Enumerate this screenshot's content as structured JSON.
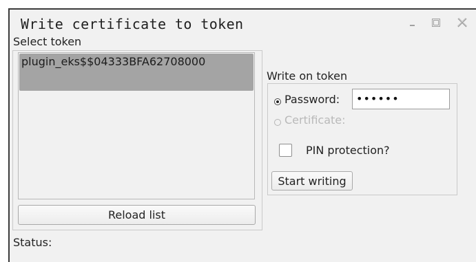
{
  "window": {
    "title": "Write certificate to token"
  },
  "select": {
    "label": "Select token",
    "tokens": [
      {
        "label": "plugin_eks$$04333BFA62708000"
      }
    ],
    "reload_label": "Reload list"
  },
  "write": {
    "label": "Write on token",
    "password_label": "Password:",
    "password_value": "••••••",
    "certificate_label": "Certificate:",
    "pin_label": "PIN protection?",
    "start_label": "Start writing"
  },
  "status": {
    "label": "Status:"
  },
  "icons": {
    "minimize": "minimize-icon",
    "maximize": "maximize-icon",
    "close": "close-icon"
  }
}
